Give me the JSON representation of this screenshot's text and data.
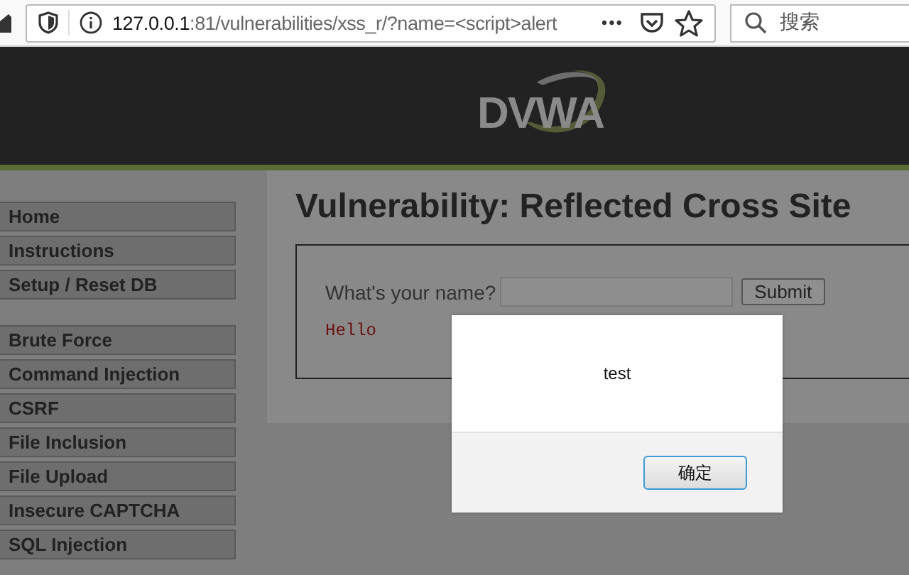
{
  "browser": {
    "url_host": "127.0.0.1",
    "url_rest": ":81/vulnerabilities/xss_r/?name=<script>alert",
    "page_actions": "•••",
    "search": {
      "placeholder": "搜索"
    }
  },
  "header": {
    "logo": "DVWA"
  },
  "sidebar": {
    "groups": [
      {
        "items": [
          "Home",
          "Instructions",
          "Setup / Reset DB"
        ]
      },
      {
        "items": [
          "Brute Force",
          "Command Injection",
          "CSRF",
          "File Inclusion",
          "File Upload",
          "Insecure CAPTCHA",
          "SQL Injection"
        ]
      }
    ]
  },
  "main": {
    "title": "Vulnerability: Reflected Cross Site",
    "form": {
      "label": "What's your name?",
      "button": "Submit"
    },
    "output": "Hello"
  },
  "alert_dialog": {
    "message": "test",
    "button": "确定"
  }
}
